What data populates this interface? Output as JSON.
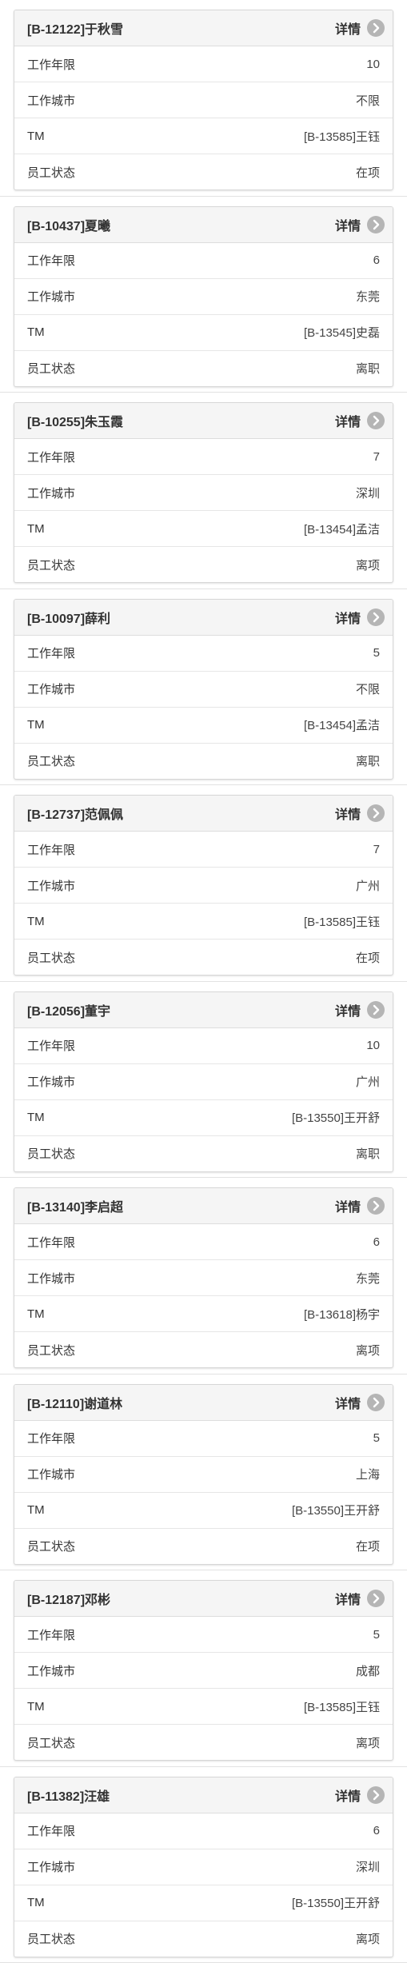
{
  "detail_label": "详情",
  "field_labels": {
    "years": "工作年限",
    "city": "工作城市",
    "tm": "TM",
    "status": "员工状态"
  },
  "icons": {
    "detail": "chevron-right-circle-icon"
  },
  "employees": [
    {
      "title": "[B-12122]于秋雪",
      "years": "10",
      "city": "不限",
      "tm": "[B-13585]王钰",
      "status": "在项"
    },
    {
      "title": "[B-10437]夏曦",
      "years": "6",
      "city": "东莞",
      "tm": "[B-13545]史磊",
      "status": "离职"
    },
    {
      "title": "[B-10255]朱玉霞",
      "years": "7",
      "city": "深圳",
      "tm": "[B-13454]孟洁",
      "status": "离项"
    },
    {
      "title": "[B-10097]薛利",
      "years": "5",
      "city": "不限",
      "tm": "[B-13454]孟洁",
      "status": "离职"
    },
    {
      "title": "[B-12737]范佩佩",
      "years": "7",
      "city": "广州",
      "tm": "[B-13585]王钰",
      "status": "在项"
    },
    {
      "title": "[B-12056]董宇",
      "years": "10",
      "city": "广州",
      "tm": "[B-13550]王开舒",
      "status": "离职"
    },
    {
      "title": "[B-13140]李启超",
      "years": "6",
      "city": "东莞",
      "tm": "[B-13618]杨宇",
      "status": "离项"
    },
    {
      "title": "[B-12110]谢道林",
      "years": "5",
      "city": "上海",
      "tm": "[B-13550]王开舒",
      "status": "在项"
    },
    {
      "title": "[B-12187]邓彬",
      "years": "5",
      "city": "成都",
      "tm": "[B-13585]王钰",
      "status": "离项"
    },
    {
      "title": "[B-11382]汪雄",
      "years": "6",
      "city": "深圳",
      "tm": "[B-13550]王开舒",
      "status": "离项"
    }
  ]
}
